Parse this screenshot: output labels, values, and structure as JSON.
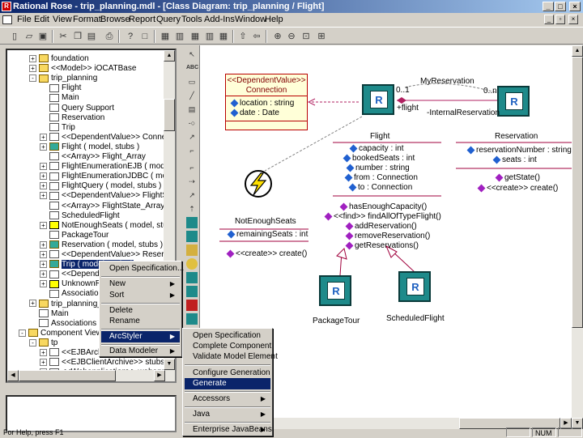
{
  "window": {
    "title": "Rational Rose - trip_planning.mdl - [Class Diagram: trip_planning / Flight]",
    "app_icon_letter": "R"
  },
  "menu": {
    "items": [
      "File",
      "Edit",
      "View",
      "Format",
      "Browse",
      "Report",
      "Query",
      "Tools",
      "Add-Ins",
      "Window",
      "Help"
    ]
  },
  "toolbar": {
    "icons": [
      "new-icon",
      "open-icon",
      "save-icon",
      "cut-icon",
      "copy-icon",
      "paste-icon",
      "print-icon",
      "context-help-icon",
      "view-doc-icon",
      "browse-class-icon",
      "browse-interaction-icon",
      "browse-component-icon",
      "browse-deployment-icon",
      "browse-parent-icon",
      "browse-previous-icon",
      "zoom-in-icon",
      "zoom-out-icon",
      "fit-in-window-icon",
      "undo-fit-icon"
    ]
  },
  "browser": {
    "rows": [
      {
        "indent": 1,
        "exp": "+",
        "icon": "folder",
        "label": "foundation"
      },
      {
        "indent": 1,
        "exp": "+",
        "icon": "folder",
        "label": "<<Model>> iOCATBase"
      },
      {
        "indent": 1,
        "exp": "-",
        "icon": "folder",
        "label": "trip_planning"
      },
      {
        "indent": 2,
        "exp": "",
        "icon": "class",
        "label": "Flight"
      },
      {
        "indent": 2,
        "exp": "",
        "icon": "class",
        "label": "Main"
      },
      {
        "indent": 2,
        "exp": "",
        "icon": "class",
        "label": "Query Support"
      },
      {
        "indent": 2,
        "exp": "",
        "icon": "class",
        "label": "Reservation"
      },
      {
        "indent": 2,
        "exp": "",
        "icon": "class",
        "label": "Trip"
      },
      {
        "indent": 2,
        "exp": "+",
        "icon": "class",
        "label": "<<DependentValue>> Connection ( mo"
      },
      {
        "indent": 2,
        "exp": "+",
        "icon": "comp",
        "label": "Flight ( model, stubs )"
      },
      {
        "indent": 2,
        "exp": "",
        "icon": "class",
        "label": "<<Array>> Flight_Array"
      },
      {
        "indent": 2,
        "exp": "+",
        "icon": "class",
        "label": "FlightEnumerationEJB ( model )"
      },
      {
        "indent": 2,
        "exp": "+",
        "icon": "class",
        "label": "FlightEnumerationJDBC ( model )"
      },
      {
        "indent": 2,
        "exp": "+",
        "icon": "class",
        "label": "FlightQuery ( model, stubs )"
      },
      {
        "indent": 2,
        "exp": "+",
        "icon": "class",
        "label": "<<DependentValue>> FlightState ( mo"
      },
      {
        "indent": 2,
        "exp": "",
        "icon": "class",
        "label": "<<Array>> FlightState_Array"
      },
      {
        "indent": 2,
        "exp": "",
        "icon": "class",
        "label": "ScheduledFlight"
      },
      {
        "indent": 2,
        "exp": "+",
        "icon": "lightning",
        "label": "NotEnoughSeats ( model, stubs )"
      },
      {
        "indent": 2,
        "exp": "",
        "icon": "class",
        "label": "PackageTour"
      },
      {
        "indent": 2,
        "exp": "+",
        "icon": "comp",
        "label": "Reservation ( model, stubs )"
      },
      {
        "indent": 2,
        "exp": "+",
        "icon": "class",
        "label": "<<DependentValue>> ReservationSta"
      },
      {
        "indent": 2,
        "exp": "+",
        "icon": "comp",
        "label": "Trip ( model, stubs )",
        "selected": true
      },
      {
        "indent": 2,
        "exp": "+",
        "icon": "class",
        "label": "<<DependentV"
      },
      {
        "indent": 2,
        "exp": "+",
        "icon": "lightning",
        "label": "UnknownRese"
      },
      {
        "indent": 2,
        "exp": "",
        "icon": "class",
        "label": "Associations"
      },
      {
        "indent": 1,
        "exp": "+",
        "icon": "folder",
        "label": "trip_planning_app"
      },
      {
        "indent": 1,
        "exp": "",
        "icon": "class",
        "label": "Main"
      },
      {
        "indent": 1,
        "exp": "",
        "icon": "class",
        "label": "Associations"
      },
      {
        "indent": 0,
        "exp": "-",
        "icon": "folder",
        "label": "Component View"
      },
      {
        "indent": 1,
        "exp": "-",
        "icon": "folder",
        "label": "tp"
      },
      {
        "indent": 2,
        "exp": "+",
        "icon": "class",
        "label": "<<EJBArchive>>"
      },
      {
        "indent": 2,
        "exp": "+",
        "icon": "class",
        "label": "<<EJBClientArchive>> stubs"
      },
      {
        "indent": 2,
        "exp": "+",
        "icon": "class",
        "label": "<<Webapplication>> webapp"
      }
    ]
  },
  "palette": {
    "icons": [
      "selection-arrow-icon",
      "text-box-icon",
      "note-icon",
      "anchor-note-icon",
      "class-icon",
      "interface-icon",
      "unidirectional-association-icon",
      "association-class-icon",
      "package-icon",
      "dependency-icon",
      "generalization-icon",
      "realize-icon",
      "ejb-icon",
      "servlet-icon",
      "jsp-icon",
      "component-icon",
      "entity-bean-icon",
      "session-bean-icon",
      "message-bean-icon",
      "web-module-icon"
    ],
    "labels": [
      "ABC"
    ]
  },
  "diagram": {
    "dependent_value": {
      "stereotype": "<<DependentValue>>",
      "name": "Connection",
      "attributes": [
        "location : string",
        "date : Date"
      ]
    },
    "flight": {
      "name": "Flight",
      "icon_letter": "R",
      "attributes": [
        "capacity : int",
        "bookedSeats : int",
        "number : string",
        "from : Connection",
        "to : Connection"
      ],
      "operations": [
        "hasEnoughCapacity()",
        "<<find>> findAllOfTypeFlight()",
        "addReservation()",
        "removeReservation()",
        "getReservations()"
      ]
    },
    "reservation": {
      "name": "Reservation",
      "icon_letter": "R",
      "attributes": [
        "reservationNumber : string",
        "seats : int"
      ],
      "operations": [
        "getState()",
        "<<create>> create()"
      ]
    },
    "not_enough_seats": {
      "name": "NotEnoughSeats",
      "attributes": [
        "remainingSeats : int"
      ],
      "operations": [
        "<<create>> create()"
      ]
    },
    "package_tour": {
      "name": "PackageTour",
      "icon_letter": "R"
    },
    "scheduled_flight": {
      "name": "ScheduledFlight",
      "icon_letter": "R"
    },
    "association": {
      "name": "MyReservation",
      "mult_left": "0..1",
      "mult_right": "0..n",
      "role_left": "+flight",
      "role_right": "-InternalReservation"
    }
  },
  "context_menu": {
    "items": [
      {
        "label": "Open Specification...",
        "arrow": false
      },
      {
        "label": "New",
        "arrow": true
      },
      {
        "label": "Sort",
        "arrow": true
      },
      {
        "label": "Delete",
        "arrow": false
      },
      {
        "label": "Rename",
        "arrow": false
      },
      {
        "label": "ArcStyler",
        "arrow": true,
        "highlighted": true
      },
      {
        "label": "Data Modeler",
        "arrow": true
      }
    ]
  },
  "arcstyler_menu": {
    "items": [
      {
        "label": "Open Specification",
        "arrow": false
      },
      {
        "label": "Complete Component",
        "arrow": false
      },
      {
        "label": "Validate Model Element",
        "arrow": false
      },
      {
        "label": "Configure Generation",
        "arrow": false
      },
      {
        "label": "Generate",
        "arrow": false,
        "highlighted": true
      },
      {
        "label": "Accessors",
        "arrow": true
      },
      {
        "label": "Java",
        "arrow": true
      },
      {
        "label": "Enterprise JavaBeans",
        "arrow": true
      }
    ]
  },
  "status": {
    "help": "For Help, press F1",
    "num": "NUM"
  },
  "colors": {
    "title_start": "#0a246a",
    "title_end": "#a6caf0",
    "selection": "#0a246a",
    "dependent_border": "#b80000",
    "dependent_fill": "#ffffd8",
    "class_line": "#a0003c",
    "class_icon": "#1e8a8a"
  }
}
